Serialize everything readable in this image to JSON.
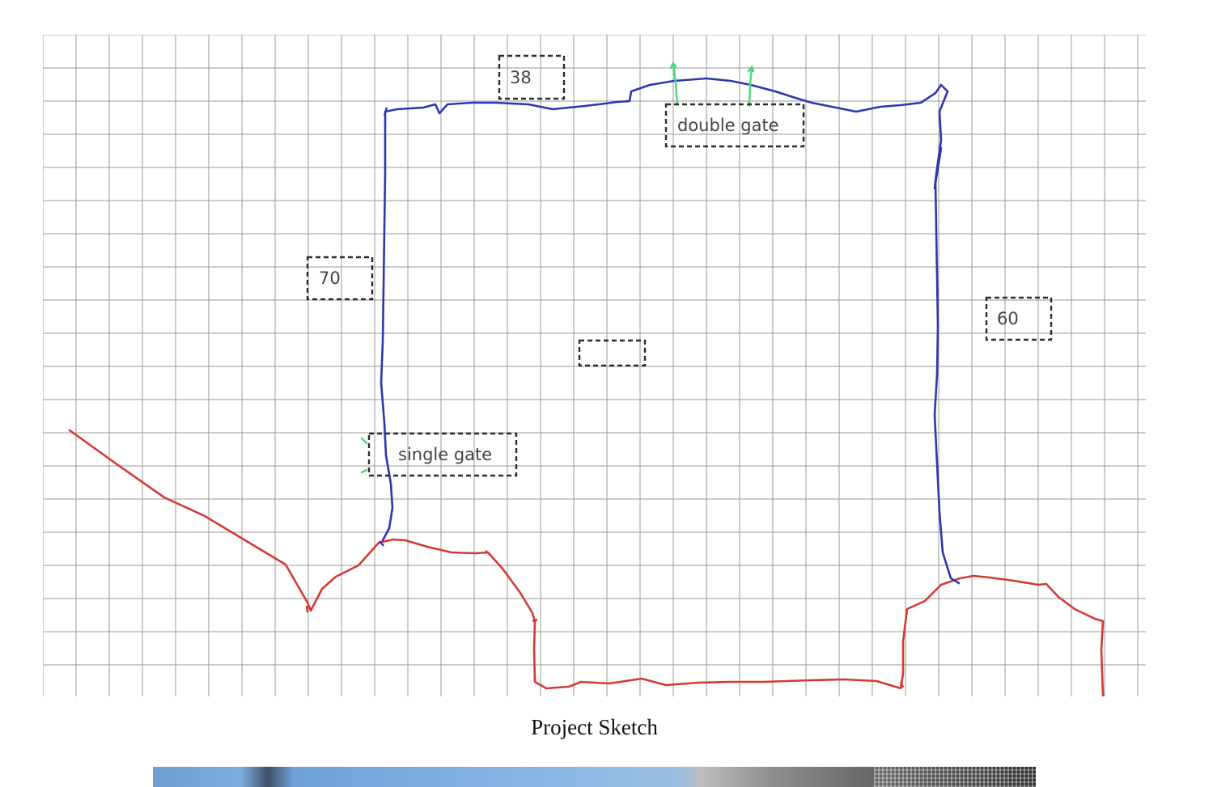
{
  "sketch": {
    "labels": {
      "top_dimension": "38",
      "left_dimension": "70",
      "right_dimension": "60",
      "center_box": "",
      "double_gate": "double gate",
      "single_gate": "single gate"
    },
    "colors": {
      "grid_line": "#9a9a9a",
      "fence": "#2e36b0",
      "property_line": "#d43a34",
      "gate_marks": "#49d87a",
      "label_border": "#2b2b2b"
    }
  },
  "caption": "Project Sketch",
  "photo": {
    "description_icon": "photo-preview"
  }
}
